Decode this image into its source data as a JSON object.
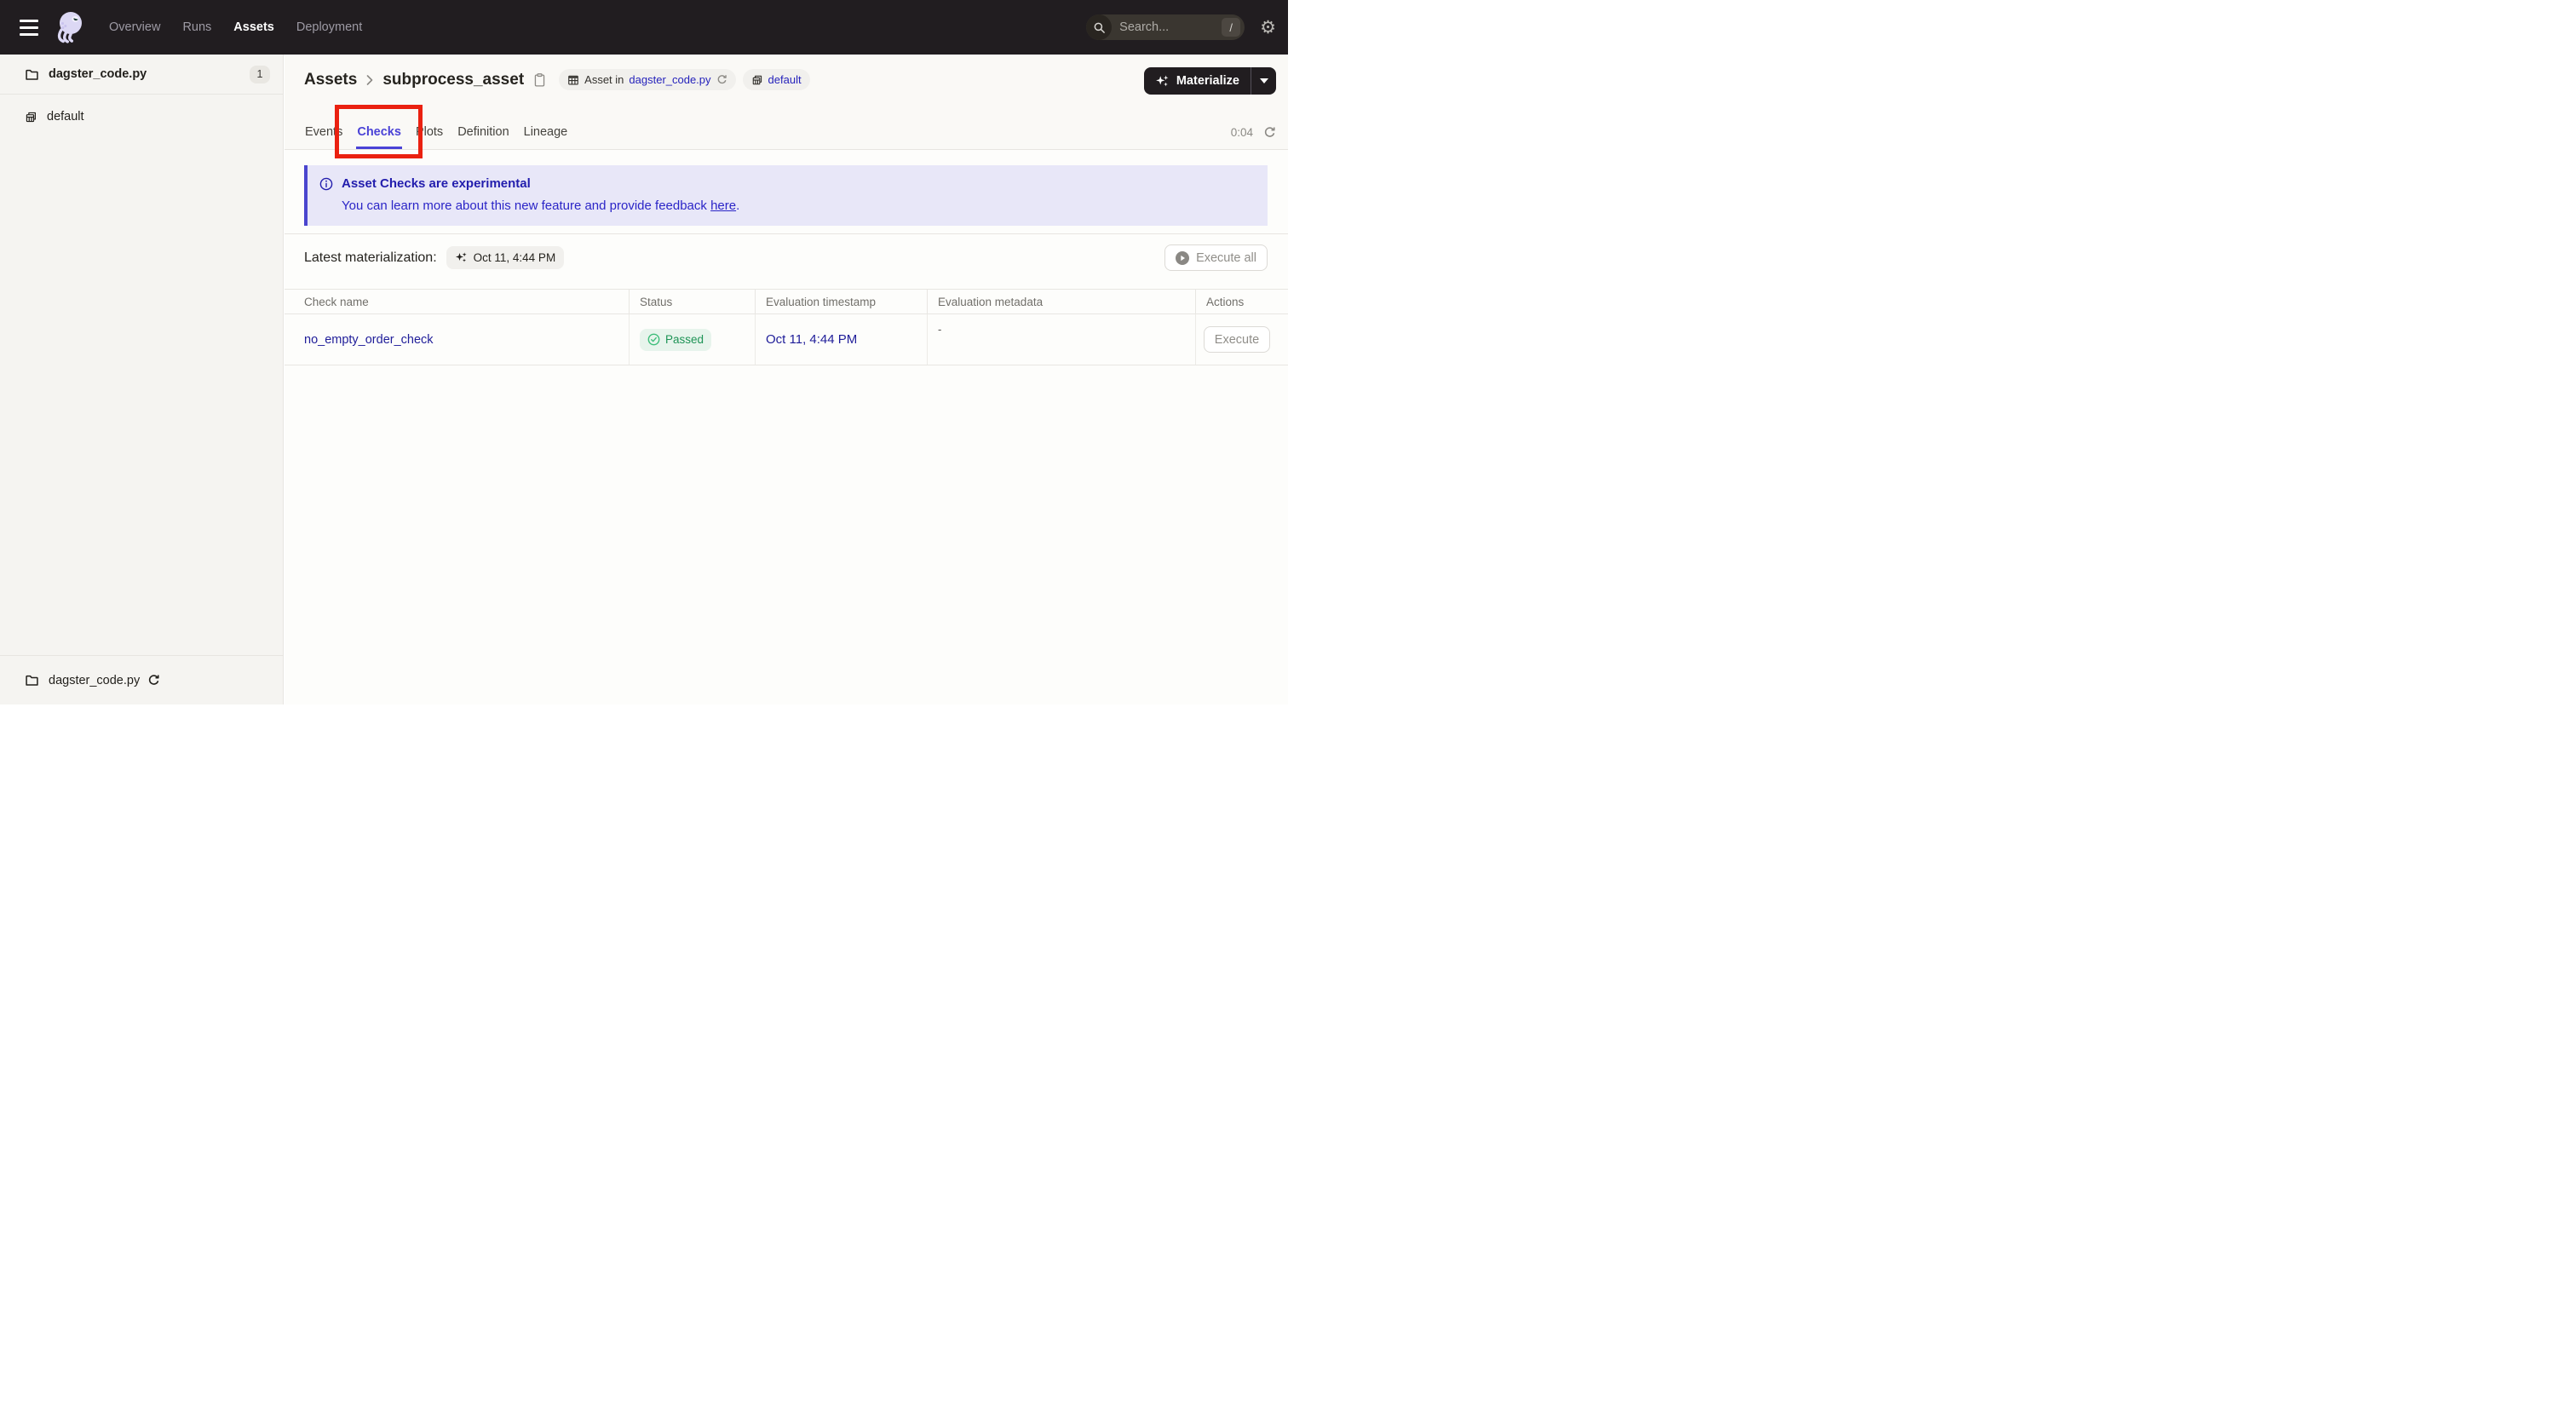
{
  "colors": {
    "nav_background": "#211d20",
    "accent_indigo": "#4a42d6",
    "banner_background": "#e8e7f8",
    "banner_text": "#221dad",
    "link_blue": "#1f1d99",
    "status_green_text": "#1d9355",
    "status_green_bg": "#e7f4ec",
    "annotation_red": "#ea2110"
  },
  "icons": {
    "menu": "hamburger",
    "logo": "dagster-octopus",
    "search": "magnifier",
    "settings": "gear",
    "folder": "folder-outline",
    "asset_group": "grid-sheets",
    "copy": "clipboard",
    "asset_table": "spreadsheet",
    "refresh": "circular-arrow",
    "sparkles": "four-point-stars",
    "caret": "triangle-down",
    "info": "circled-i",
    "play": "play-in-circle",
    "check": "check-in-circle",
    "chevron": "angle-right"
  },
  "topnav": {
    "nav_items": [
      {
        "label": "Overview",
        "active": false
      },
      {
        "label": "Runs",
        "active": false
      },
      {
        "label": "Assets",
        "active": true
      },
      {
        "label": "Deployment",
        "active": false
      }
    ],
    "search_placeholder": "Search...",
    "search_shortcut": "/"
  },
  "sidebar": {
    "top_item": {
      "label": "dagster_code.py",
      "count": "1"
    },
    "group_item": {
      "label": "default"
    },
    "bottom_item": {
      "label": "dagster_code.py"
    }
  },
  "header": {
    "breadcrumb_root": "Assets",
    "asset_name": "subprocess_asset",
    "asset_in_prefix": "Asset in",
    "asset_in_link": "dagster_code.py",
    "group_badge": "default",
    "materialize_label": "Materialize"
  },
  "tabs": {
    "items": [
      {
        "label": "Events",
        "active": false
      },
      {
        "label": "Checks",
        "active": true
      },
      {
        "label": "Plots",
        "active": false
      },
      {
        "label": "Definition",
        "active": false
      },
      {
        "label": "Lineage",
        "active": false
      }
    ],
    "timer": "0:04"
  },
  "banner": {
    "title": "Asset Checks are experimental",
    "body_prefix": "You can learn more about this new feature and provide feedback ",
    "link_text": "here",
    "body_suffix": "."
  },
  "latest": {
    "label": "Latest materialization:",
    "timestamp": "Oct 11, 4:44 PM",
    "execute_all_label": "Execute all"
  },
  "table": {
    "columns": [
      "Check name",
      "Status",
      "Evaluation timestamp",
      "Evaluation metadata",
      "Actions"
    ],
    "rows": [
      {
        "name": "no_empty_order_check",
        "status": "Passed",
        "timestamp": "Oct 11, 4:44 PM",
        "metadata": "-",
        "action": "Execute"
      }
    ]
  }
}
